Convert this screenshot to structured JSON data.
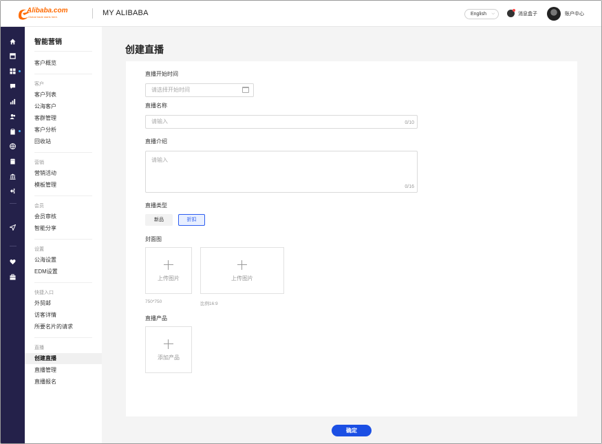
{
  "header": {
    "logo_text": "Alibaba.com",
    "logo_tagline": "Global trade starts here.",
    "app_title": "MY ALIBABA",
    "language": "English",
    "messages_label": "消息盒子",
    "account_label": "账户中心"
  },
  "rail": {
    "icons": [
      "home-icon",
      "store-icon",
      "apps-icon",
      "chat-icon",
      "chart-icon",
      "users-icon",
      "clipboard-icon",
      "globe-icon",
      "shop-icon",
      "bank-icon",
      "transfer-icon",
      "send-icon",
      "heart-icon",
      "briefcase-icon"
    ]
  },
  "sidebar": {
    "title": "智能营销",
    "overview": "客户概览",
    "groups": {
      "customer": "客户",
      "marketing": "营销",
      "member": "会员",
      "settings": "设置",
      "shortcuts": "快捷入口",
      "live": "直播"
    },
    "items": {
      "customer_list": "客户列表",
      "public_customers": "公海客户",
      "segments": "客群管理",
      "analysis": "客户分析",
      "recycle": "回收站",
      "campaigns": "营销活动",
      "templates": "模板管理",
      "member_review": "会员审核",
      "smart_share": "智能分享",
      "public_settings": "公海设置",
      "edm_settings": "EDM设置",
      "trade_dept": "外贸邮",
      "visitor_detail": "访客详情",
      "card_requests": "所要名片的请求",
      "create_live": "创建直播",
      "manage_live": "直播管理",
      "live_signup": "直播报名"
    }
  },
  "form": {
    "page_title": "创建直播",
    "start_time_label": "直播开始时间",
    "start_time_placeholder": "请选择开始时间",
    "name_label": "直播名称",
    "name_placeholder": "请输入",
    "name_counter": "0/10",
    "intro_label": "直播介绍",
    "intro_placeholder": "请输入",
    "intro_counter": "0/16",
    "type_label": "直播类型",
    "type_options": [
      "新品",
      "折扣"
    ],
    "selected_type": "折扣",
    "cover_label": "封面图",
    "upload_text": "上传图片",
    "cover_hint_1": "750*750",
    "cover_hint_2": "比例16:9",
    "product_label": "直播产品",
    "add_product_text": "添加产品",
    "confirm_label": "确定"
  },
  "colors": {
    "rail_bg": "#24214a",
    "primary": "#1b4fe4",
    "brand": "#ff6a00"
  }
}
